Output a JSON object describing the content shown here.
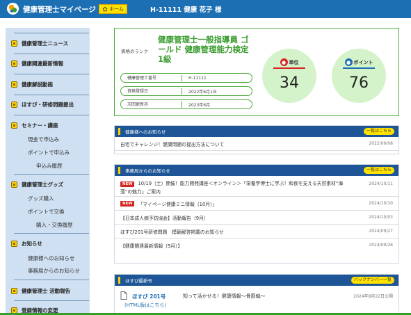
{
  "header": {
    "site_title": "健康管理士マイページ",
    "home_label": "ホーム",
    "user_info": "H-11111  健康 花子 様"
  },
  "sidebar": {
    "items": [
      {
        "label": "健康管理士ニュース",
        "icon": "newspaper-icon"
      },
      {
        "label": "健康関連最新情報",
        "icon": "megaphone-icon"
      },
      {
        "label": "健康解説動画",
        "icon": "film-icon"
      },
      {
        "label": "ほすぴ・研修問題提出",
        "icon": "book-icon"
      },
      {
        "label": "セミナー・講座",
        "icon": "document-icon",
        "sub": [
          "現金で申込み",
          "ポイントで申込み",
          "申込み履歴"
        ]
      },
      {
        "label": "健康管理士グッズ",
        "icon": "cart-icon",
        "sub": [
          "グッズ購入",
          "ポイントで交換",
          "購入・交換履歴"
        ]
      },
      {
        "label": "お知らせ",
        "icon": "notice-icon",
        "sub": [
          "健康様へのお知らせ",
          "事務局からのお知らせ"
        ]
      },
      {
        "label": "健康管理士 活動報告",
        "icon": "speech-icon"
      },
      {
        "label": "登録情報の変更",
        "icon": "profile-icon"
      }
    ]
  },
  "rank": {
    "label": "資格のランク",
    "title": "健康管理士一般指導員 ゴールド 健康管理能力検定1級",
    "fields": [
      {
        "key": "健康管理士番号",
        "value": "H-11111"
      },
      {
        "key": "資格登録日",
        "value": "2022年6月1日"
      },
      {
        "key": "次回更新月",
        "value": "2023年6月"
      }
    ],
    "units_label": "単位",
    "units_value": "34",
    "units_color": "#d6241f",
    "points_label": "ポイント",
    "points_value": "76",
    "points_color": "#1d6fb3"
  },
  "notice_user": {
    "title": "健康様へのお知らせ",
    "more_label": "一覧はこちら",
    "rows": [
      {
        "text": "自宅でチャレンジ！健康問題の提出方法について",
        "date": "2022/09/08"
      }
    ]
  },
  "notice_office": {
    "title": "事務局からのお知らせ",
    "more_label": "一覧はこちら",
    "new_label": "NEW",
    "rows": [
      {
        "text": "10/19（土）開催！能力開発講座＜オンライン＞「栄養学博士に学ぶ！和食を支える天然素材“海藻”の魅力」ご案内",
        "date": "2024/10/11",
        "new": true
      },
      {
        "text": "「マイページ健康ミニ情報（10月）」",
        "date": "2024/10/10",
        "new": true
      },
      {
        "text": "【日本成人病予防協会】活動報告（9月）",
        "date": "2024/10/03",
        "new": false
      },
      {
        "text": "ほすぴ201号研修問題　模範解答掲載のお知らせ",
        "date": "2024/09/27",
        "new": false
      },
      {
        "text": "【健康関連最新情報（9月）】",
        "date": "2024/09/26",
        "new": false
      }
    ]
  },
  "hospi": {
    "title": "ほすぴ最新号",
    "more_label": "バックナンバー一覧",
    "issue": "ほすぴ 201号",
    "headline": "知って活かせる！健康情報〜骨筋編〜",
    "html_link": "(HTML版はこちら)",
    "date": "2024年8月22日公開"
  }
}
